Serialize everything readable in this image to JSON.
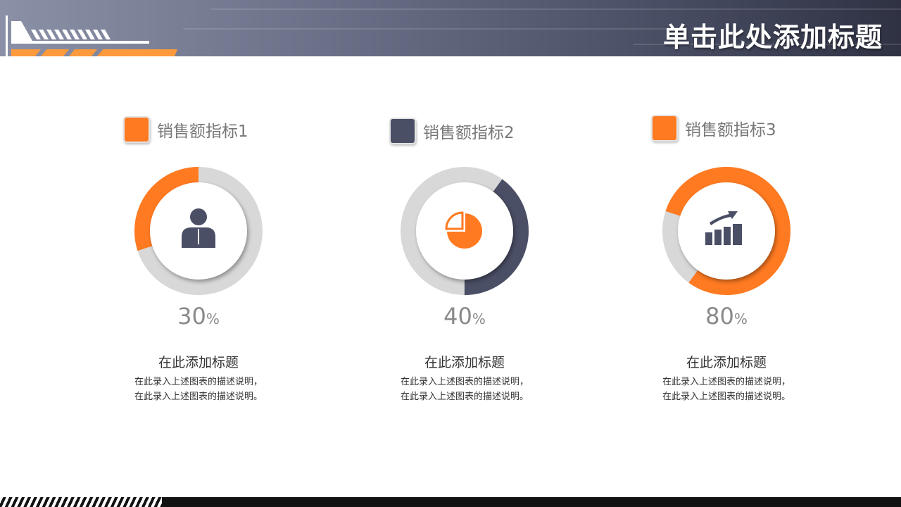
{
  "header": {
    "title": "单击此处添加标题"
  },
  "colors": {
    "orange": "#ff7a21",
    "slate": "#4a4f66",
    "track": "#d8d8d8"
  },
  "chart_data": [
    {
      "type": "pie",
      "series_label": "销售额指标1",
      "value": 30,
      "value_text": "30",
      "unit": "%",
      "color": "#ff7a21",
      "icon": "person-icon",
      "item_title": "在此添加标题",
      "desc_line1": "在此录入上述图表的描述说明，",
      "desc_line2": "在此录入上述图表的描述说明。"
    },
    {
      "type": "pie",
      "series_label": "销售额指标2",
      "value": 40,
      "value_text": "40",
      "unit": "%",
      "color": "#4a4f66",
      "icon": "pie-chart-icon",
      "item_title": "在此添加标题",
      "desc_line1": "在此录入上述图表的描述说明，",
      "desc_line2": "在此录入上述图表的描述说明。"
    },
    {
      "type": "pie",
      "series_label": "销售额指标3",
      "value": 80,
      "value_text": "80",
      "unit": "%",
      "color": "#ff7a21",
      "icon": "bar-chart-trend-icon",
      "item_title": "在此添加标题",
      "desc_line1": "在此录入上述图表的描述说明，",
      "desc_line2": "在此录入上述图表的描述说明。"
    }
  ]
}
